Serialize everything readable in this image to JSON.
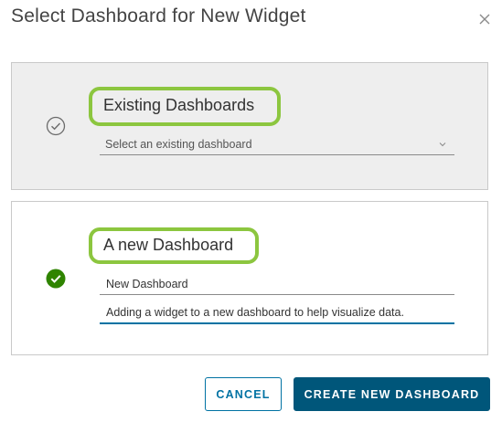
{
  "dialog": {
    "title": "Select Dashboard for New Widget",
    "close_icon": "close-icon"
  },
  "existing_option": {
    "title": "Existing Dashboards",
    "status_icon": "check-circle-outline-icon",
    "selected": false,
    "select_placeholder": "Select an existing dashboard",
    "caret_icon": "chevron-down-icon"
  },
  "new_option": {
    "title": "A new Dashboard",
    "status_icon": "check-circle-filled-icon",
    "selected": true,
    "name_value": "New Dashboard",
    "description_value": "Adding a widget to a new dashboard to help visualize data."
  },
  "footer": {
    "cancel_label": "CANCEL",
    "create_label": "CREATE NEW DASHBOARD"
  },
  "colors": {
    "highlight_outline": "#8cc63f",
    "selected_check": "#2f8400",
    "primary_button": "#00567a",
    "link_blue": "#0072a3",
    "existing_card_bg": "#eeeeee"
  }
}
